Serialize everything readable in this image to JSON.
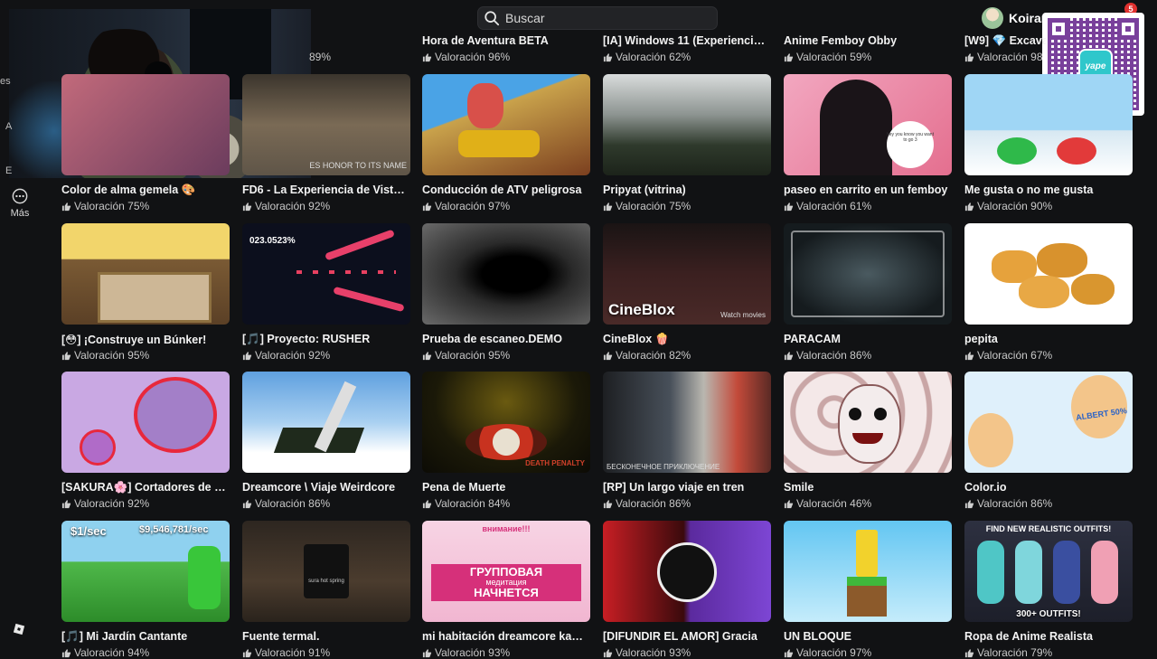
{
  "topbar": {
    "search_placeholder": "Buscar",
    "username": "Koiran",
    "notification_count": "5"
  },
  "qr": {
    "logo_text": "yape"
  },
  "sidebar": {
    "more_label": "Más",
    "fragments": [
      "es",
      "A",
      "E"
    ]
  },
  "top_row": [
    {
      "title": "",
      "rating": "89%"
    },
    {
      "title": "Hora de Aventura BETA",
      "rating": "Valoración 96%"
    },
    {
      "title": "[IA] Windows 11 (Experiencia re...",
      "rating": "Valoración 62%"
    },
    {
      "title": "Anime Femboy Obby",
      "rating": "Valoración 59%"
    },
    {
      "title": "[W9] 💎 Excava",
      "rating": "Valoración 98"
    }
  ],
  "rows": [
    [
      {
        "title": "Color de alma gemela 🎨",
        "rating": "Valoración 75%"
      },
      {
        "title": "FD6 - La Experiencia de Vista al ...",
        "rating": "Valoración 92%",
        "caption_sub": "ES HONOR TO ITS NAME"
      },
      {
        "title": "Conducción de ATV peligrosa",
        "rating": "Valoración 97%"
      },
      {
        "title": "Pripyat (vitrina)",
        "rating": "Valoración 75%"
      },
      {
        "title": "paseo en carrito en un femboy",
        "rating": "Valoración 61%",
        "bubble": "hey you know you want to go 3"
      },
      {
        "title": "Me gusta o no me gusta",
        "rating": "Valoración 90%"
      }
    ],
    [
      {
        "title": "[😳] ¡Construye un Búnker!",
        "rating": "Valoración 95%"
      },
      {
        "title": "[🎵] Proyecto: RUSHER",
        "rating": "Valoración 92%",
        "hud": "023.0523%"
      },
      {
        "title": "Prueba de escaneo.DEMO",
        "rating": "Valoración 95%"
      },
      {
        "title": "CineBlox 🍿",
        "rating": "Valoración 82%",
        "caption": "CineBlox",
        "caption_sub": "Watch movies"
      },
      {
        "title": "PARACAM",
        "rating": "Valoración 86%"
      },
      {
        "title": "pepita",
        "rating": "Valoración 67%"
      }
    ],
    [
      {
        "title": "[SAKURA🌸] Cortadores de hier...",
        "rating": "Valoración 92%"
      },
      {
        "title": "Dreamcore \\ Viaje Weirdcore",
        "rating": "Valoración 86%"
      },
      {
        "title": "Pena de Muerte",
        "rating": "Valoración 84%",
        "caption_sub": "DEATH PENALTY"
      },
      {
        "title": "[RP] Un largo viaje en tren",
        "rating": "Valoración 86%",
        "caption_sub": "БЕСКОНЕЧНОЕ ПРИКЛЮЧЕНИЕ"
      },
      {
        "title": "Smile",
        "rating": "Valoración 46%"
      },
      {
        "title": "Color.io",
        "rating": "Valoración 86%",
        "side": "ALBERT 50%"
      }
    ],
    [
      {
        "title": "[🎵] Mi Jardín Cantante",
        "rating": "Valoración 94%",
        "price_left": "$1/sec",
        "price_right": "$9,546,781/sec"
      },
      {
        "title": "Fuente termal.",
        "rating": "Valoración 91%",
        "sub": "sura hot spring"
      },
      {
        "title": "mi habitación dreamcore kawaii",
        "rating": "Valoración 93%",
        "banner": "внимание!!!",
        "ru_main": "ГРУППОВАЯ",
        "ru_small": "медитация",
        "ru_sub": "НАЧНЕТСЯ"
      },
      {
        "title": "[DIFUNDIR EL AMOR] Gracia",
        "rating": "Valoración 93%"
      },
      {
        "title": "UN BLOQUE",
        "rating": "Valoración 97%"
      },
      {
        "title": "Ropa de Anime Realista",
        "rating": "Valoración 79%",
        "banner": "FIND NEW REALISTIC OUTFITS!",
        "bottom": "300+ OUTFITS!"
      }
    ]
  ]
}
